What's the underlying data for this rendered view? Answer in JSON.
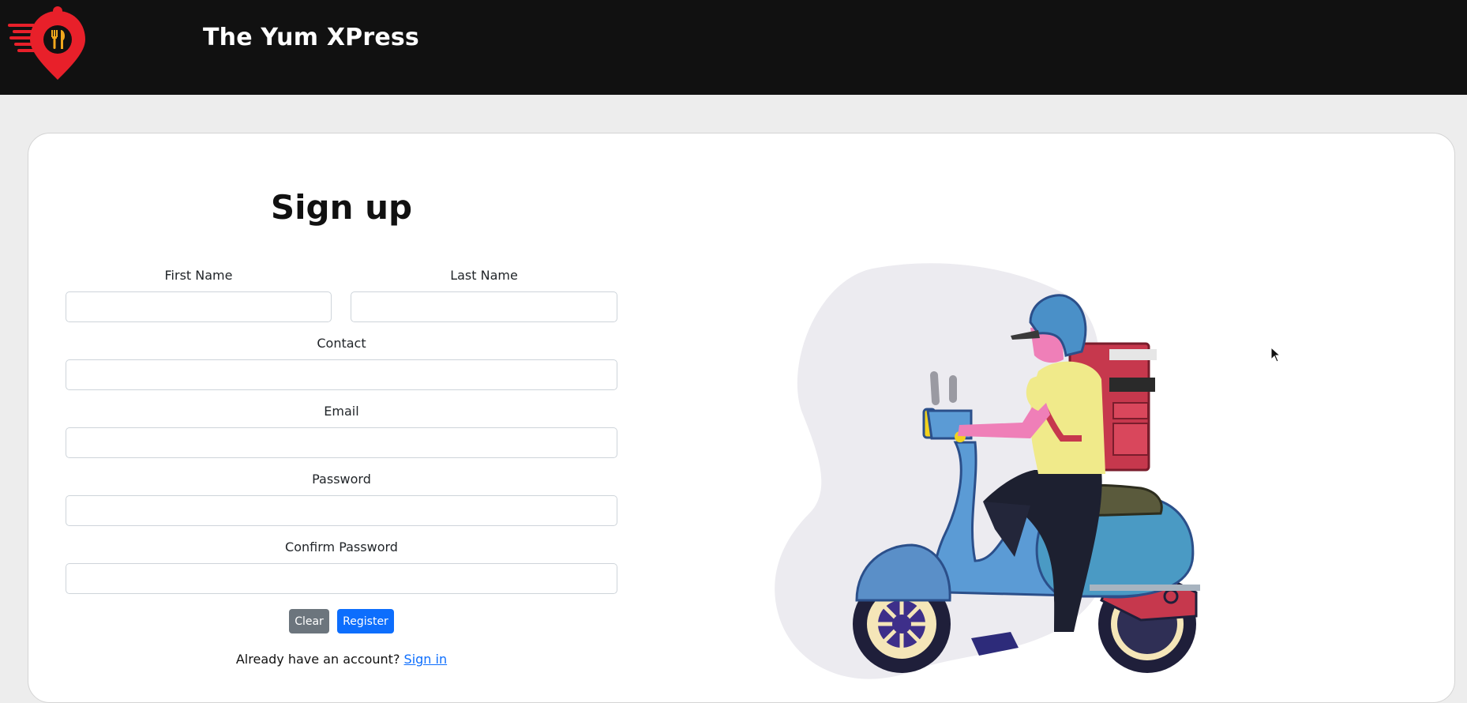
{
  "header": {
    "brand": "The Yum XPress",
    "logo_icon": "map-pin-fork-knife-logo",
    "background": "#111111",
    "logo_color": "#e8202a"
  },
  "form": {
    "title": "Sign up",
    "fields": {
      "first_name": {
        "label": "First Name",
        "value": ""
      },
      "last_name": {
        "label": "Last Name",
        "value": ""
      },
      "contact": {
        "label": "Contact",
        "value": ""
      },
      "email": {
        "label": "Email",
        "value": ""
      },
      "password": {
        "label": "Password",
        "value": ""
      },
      "confirm_password": {
        "label": "Confirm Password",
        "value": ""
      }
    },
    "buttons": {
      "clear": "Clear",
      "register": "Register"
    },
    "footer": {
      "prompt": "Already have an account?",
      "link": "Sign in"
    }
  },
  "illustration": {
    "subject": "delivery-rider-on-scooter",
    "colors": {
      "blob": "#ecebf0",
      "scooter": "#5b9bd5",
      "helmet": "#4a90c8",
      "shirt": "#f0ea8a",
      "skin": "#ef7fb8",
      "box": "#c6384d",
      "pants": "#1d2030"
    }
  },
  "colors": {
    "page_bg": "#ededed",
    "primary": "#0d6efd",
    "secondary": "#6c757d"
  }
}
